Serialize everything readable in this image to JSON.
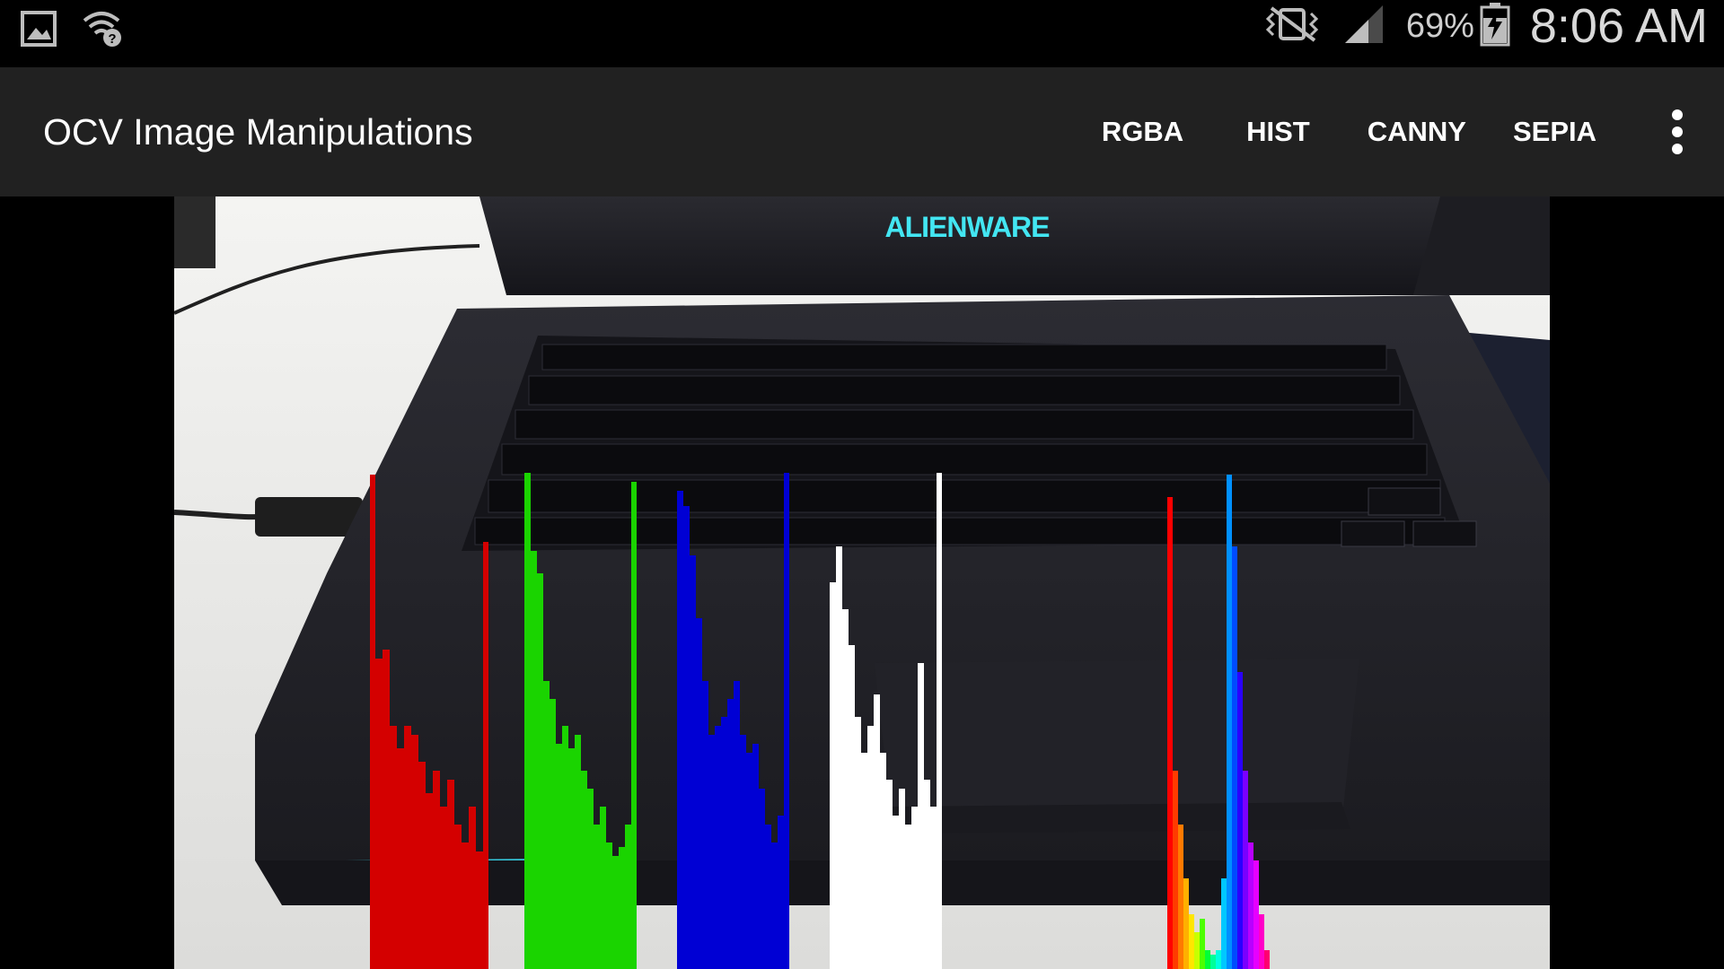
{
  "status_bar": {
    "icons_left": [
      "gallery-icon",
      "wifi-question-icon"
    ],
    "icons_right": [
      "vibrate-mute-icon",
      "signal-icon",
      "battery-charging-icon"
    ],
    "battery_percent": "69%",
    "time": "8:06 AM"
  },
  "action_bar": {
    "title": "OCV Image Manipulations",
    "menu": [
      {
        "label": "RGBA"
      },
      {
        "label": "HIST"
      },
      {
        "label": "CANNY"
      },
      {
        "label": "SEPIA"
      }
    ],
    "overflow_icon": "more-vert-icon"
  },
  "camera": {
    "brand_text": "ALIENWARE",
    "histogram_colors": {
      "red": "#d40000",
      "green": "#1ad400",
      "blue": "#0000d4",
      "value": "#ffffff"
    }
  }
}
